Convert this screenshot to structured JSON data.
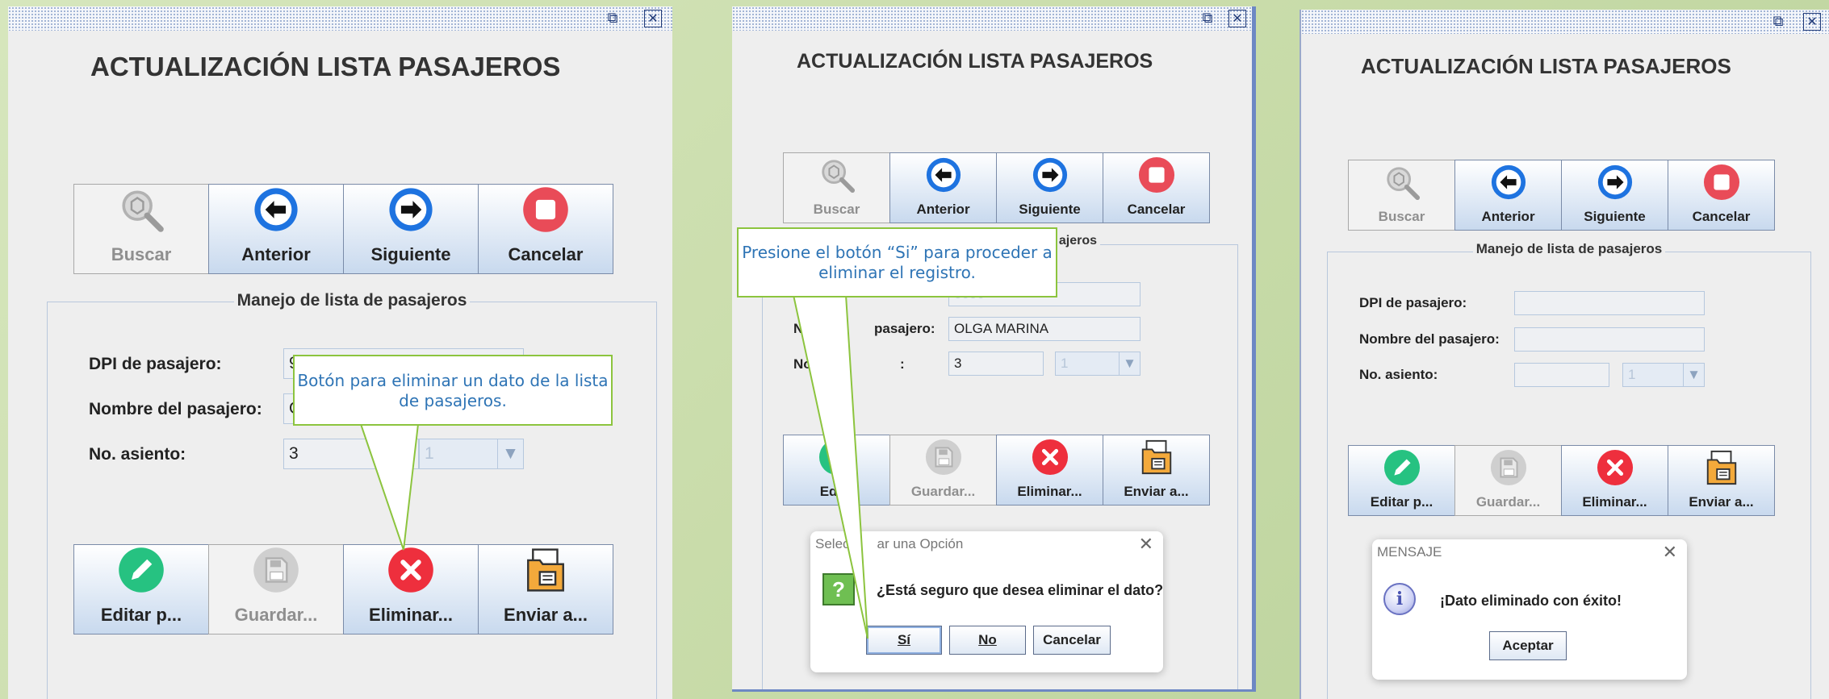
{
  "windows": [
    {
      "title": "ACTUALIZACIÓN LISTA PASAJEROS",
      "titlebar": {
        "max_icon": "maximize-icon",
        "close_icon": "close-icon"
      },
      "toolbar": [
        {
          "label": "Buscar",
          "icon": "search-icon",
          "enabled": false
        },
        {
          "label": "Anterior",
          "icon": "arrow-left-icon",
          "enabled": true
        },
        {
          "label": "Siguiente",
          "icon": "arrow-right-icon",
          "enabled": true
        },
        {
          "label": "Cancelar",
          "icon": "stop-icon",
          "enabled": true
        }
      ],
      "group_title": "Manejo de lista de pasajeros",
      "fields": {
        "dpi_label": "DPI de pasajero:",
        "dpi_value": "9",
        "nombre_label": "Nombre del pasajero:",
        "nombre_value": "O",
        "asiento_label": "No. asiento:",
        "asiento_value": "3",
        "combo_value": "1"
      },
      "actions": [
        {
          "label": "Editar p...",
          "icon": "edit-icon",
          "enabled": true
        },
        {
          "label": "Guardar...",
          "icon": "save-icon",
          "enabled": false
        },
        {
          "label": "Eliminar...",
          "icon": "delete-icon",
          "enabled": true
        },
        {
          "label": "Enviar a...",
          "icon": "folder-icon",
          "enabled": true
        }
      ],
      "callout": "Botón para eliminar un dato de la lista de pasajeros."
    },
    {
      "title": "ACTUALIZACIÓN LISTA PASAJEROS",
      "toolbar": [
        {
          "label": "Buscar",
          "enabled": false
        },
        {
          "label": "Anterior",
          "enabled": true
        },
        {
          "label": "Siguiente",
          "enabled": true
        },
        {
          "label": "Cancelar",
          "enabled": true
        }
      ],
      "group_title_fragment": "ajeros",
      "fields": {
        "dpi_value_fragment": "0000",
        "nombre_label_fragment": "pasajero:",
        "nombre_label_start": "N",
        "nombre_value": "OLGA MARINA",
        "asiento_label_start": "No",
        "asiento_label_end": ":",
        "asiento_value": "3",
        "combo_value": "1"
      },
      "actions": [
        {
          "label": "Edita",
          "enabled": true
        },
        {
          "label": "Guardar...",
          "enabled": false
        },
        {
          "label": "Eliminar...",
          "enabled": true
        },
        {
          "label": "Enviar a...",
          "enabled": true
        }
      ],
      "callout": "Presione el botón “Si” para proceder a eliminar el registro.",
      "dialog": {
        "title_start": "Selec",
        "title_end": "ar una Opción",
        "question_icon": "question-icon",
        "message": "¿Está seguro que desea eliminar el dato?",
        "buttons": [
          "Sí",
          "No",
          "Cancelar"
        ]
      }
    },
    {
      "title": "ACTUALIZACIÓN LISTA PASAJEROS",
      "toolbar": [
        {
          "label": "Buscar",
          "enabled": false
        },
        {
          "label": "Anterior",
          "enabled": true
        },
        {
          "label": "Siguiente",
          "enabled": true
        },
        {
          "label": "Cancelar",
          "enabled": true
        }
      ],
      "group_title": "Manejo de lista de pasajeros",
      "fields": {
        "dpi_label": "DPI de pasajero:",
        "dpi_value": "",
        "nombre_label": "Nombre del pasajero:",
        "nombre_value": "",
        "asiento_label": "No. asiento:",
        "asiento_value": "",
        "combo_value": "1"
      },
      "actions": [
        {
          "label": "Editar p...",
          "enabled": true
        },
        {
          "label": "Guardar...",
          "enabled": false
        },
        {
          "label": "Eliminar...",
          "enabled": true
        },
        {
          "label": "Enviar a...",
          "enabled": true
        }
      ],
      "dialog": {
        "title": "MENSAJE",
        "info_icon": "info-icon",
        "message": "¡Dato eliminado con éxito!",
        "button": "Aceptar"
      }
    }
  ],
  "colors": {
    "background": "#c9dcaa",
    "window": "#eeeeee",
    "arrow_blue": "#1e73e0",
    "cancel_red": "#e94b58",
    "edit_green": "#26c281",
    "callout_border": "#8cc43e",
    "callout_text": "#2e74b5",
    "titlebar_dots": "#8ea4cc"
  }
}
